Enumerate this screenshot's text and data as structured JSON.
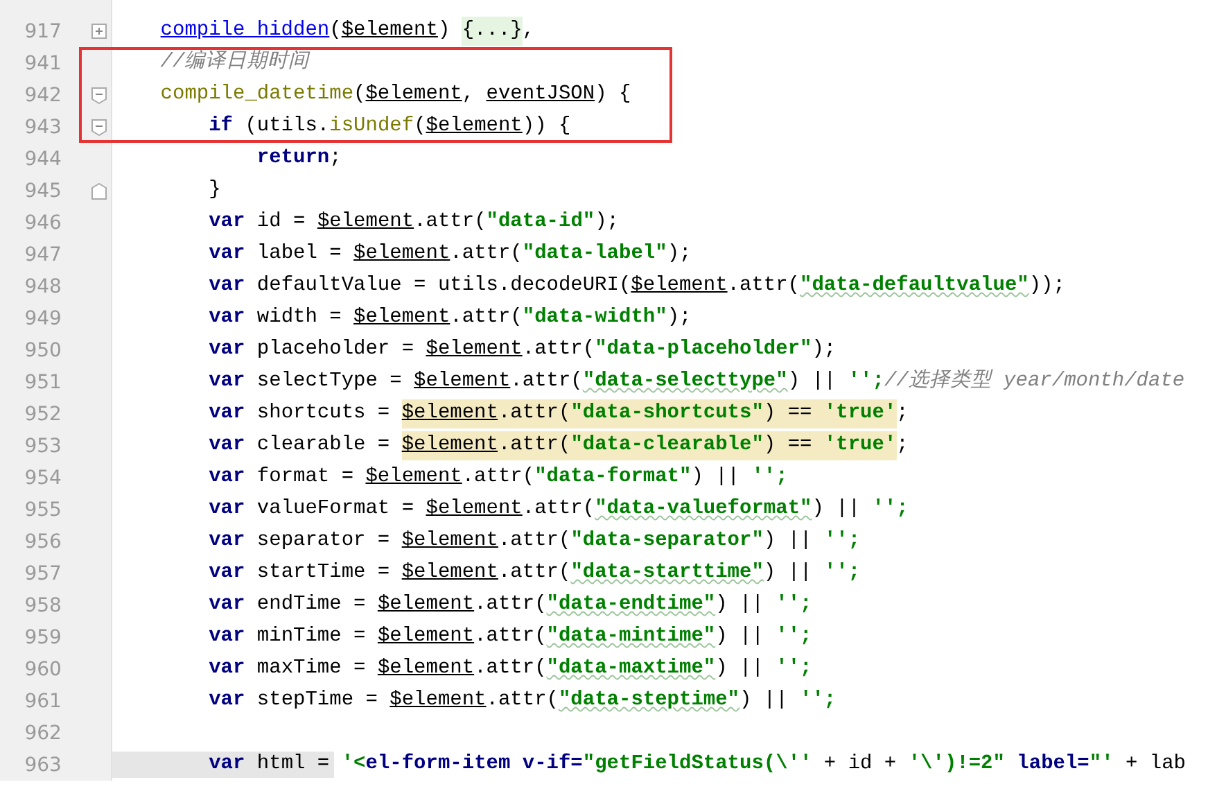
{
  "lines": [
    {
      "number": "917",
      "expanded": false,
      "tokens": [
        {
          "t": "compile hidden",
          "kind": "link"
        },
        {
          "t": "(",
          "kind": "plain"
        },
        {
          "t": "$element",
          "kind": "var"
        },
        {
          "t": ") ",
          "kind": "plain"
        },
        {
          "t": "{...}",
          "kind": "folded"
        },
        {
          "t": ",",
          "kind": "plain"
        }
      ]
    },
    {
      "number": "941",
      "boxed": true,
      "tokens": [
        {
          "t": "//编译日期时间",
          "kind": "comment"
        }
      ]
    },
    {
      "number": "942",
      "boxed": true,
      "expanded": true,
      "tokens": [
        {
          "t": "compile_datetime",
          "kind": "func"
        },
        {
          "t": "(",
          "kind": "plain"
        },
        {
          "t": "$element",
          "kind": "var"
        },
        {
          "t": ", ",
          "kind": "plain"
        },
        {
          "t": "eventJSON",
          "kind": "var"
        },
        {
          "t": ") {",
          "kind": "plain"
        }
      ],
      "children": [
        {
          "number": "943",
          "boxed": true,
          "expanded": true,
          "tokens": [
            {
              "t": "if",
              "kind": "keyword"
            },
            {
              "t": " (utils.",
              "kind": "plain"
            },
            {
              "t": "isUndef",
              "kind": "func"
            },
            {
              "t": "(",
              "kind": "plain"
            },
            {
              "t": "$element",
              "kind": "var"
            },
            {
              "t": ")) {",
              "kind": "plain"
            }
          ],
          "children": [
            {
              "number": "944",
              "tokens": [
                {
                  "t": "return",
                  "kind": "keyword"
                },
                {
                  "t": ";",
                  "kind": "plain"
                }
              ]
            }
          ]
        },
        {
          "number": "945",
          "block_end": true,
          "tokens": [
            {
              "t": "}",
              "kind": "plain"
            }
          ]
        },
        {
          "number": "946",
          "tokens": [
            {
              "t": "var",
              "kind": "keyword"
            },
            {
              "t": " id = ",
              "kind": "plain"
            },
            {
              "t": "$element",
              "kind": "var"
            },
            {
              "t": ".attr(",
              "kind": "plain"
            },
            {
              "t": "\"data-id\"",
              "kind": "string"
            },
            {
              "t": ");",
              "kind": "plain"
            }
          ]
        },
        {
          "number": "947",
          "tokens": [
            {
              "t": "var",
              "kind": "keyword"
            },
            {
              "t": " label = ",
              "kind": "plain"
            },
            {
              "t": "$element",
              "kind": "var"
            },
            {
              "t": ".attr(",
              "kind": "plain"
            },
            {
              "t": "\"data-label\"",
              "kind": "string"
            },
            {
              "t": ");",
              "kind": "plain"
            }
          ]
        },
        {
          "number": "948",
          "tokens": [
            {
              "t": "var",
              "kind": "keyword"
            },
            {
              "t": " defaultValue = utils.decodeURI(",
              "kind": "plain"
            },
            {
              "t": "$element",
              "kind": "var"
            },
            {
              "t": ".attr(",
              "kind": "plain"
            },
            {
              "t": "\"data-defaultvalue\"",
              "kind": "string",
              "typo": true
            },
            {
              "t": "));",
              "kind": "plain"
            }
          ]
        },
        {
          "number": "949",
          "tokens": [
            {
              "t": "var",
              "kind": "keyword"
            },
            {
              "t": " width = ",
              "kind": "plain"
            },
            {
              "t": "$element",
              "kind": "var"
            },
            {
              "t": ".attr(",
              "kind": "plain"
            },
            {
              "t": "\"data-width\"",
              "kind": "string"
            },
            {
              "t": ");",
              "kind": "plain"
            }
          ]
        },
        {
          "number": "950",
          "tokens": [
            {
              "t": "var",
              "kind": "keyword"
            },
            {
              "t": " placeholder = ",
              "kind": "plain"
            },
            {
              "t": "$element",
              "kind": "var"
            },
            {
              "t": ".attr(",
              "kind": "plain"
            },
            {
              "t": "\"data-placeholder\"",
              "kind": "string"
            },
            {
              "t": ");",
              "kind": "plain"
            }
          ]
        },
        {
          "number": "951",
          "tokens": [
            {
              "t": "var",
              "kind": "keyword"
            },
            {
              "t": " selectType = ",
              "kind": "plain"
            },
            {
              "t": "$element",
              "kind": "var"
            },
            {
              "t": ".attr(",
              "kind": "plain"
            },
            {
              "t": "\"data-selecttype\"",
              "kind": "string",
              "typo": true
            },
            {
              "t": ") || ",
              "kind": "plain"
            },
            {
              "t": "'';",
              "kind": "string"
            },
            {
              "t": "//选择类型 year/month/date",
              "kind": "comment"
            }
          ]
        },
        {
          "number": "952",
          "tokens": [
            {
              "t": "var",
              "kind": "keyword"
            },
            {
              "t": " shortcuts = ",
              "kind": "plain"
            },
            {
              "t": "$element",
              "kind": "var",
              "hl": true
            },
            {
              "t": ".attr(",
              "kind": "plain",
              "hl": true
            },
            {
              "t": "\"data-shortcuts\"",
              "kind": "string",
              "hl": true
            },
            {
              "t": ") == ",
              "kind": "plain",
              "hl": true
            },
            {
              "t": "'true'",
              "kind": "string",
              "hl": true
            },
            {
              "t": ";",
              "kind": "plain"
            }
          ]
        },
        {
          "number": "953",
          "tokens": [
            {
              "t": "var",
              "kind": "keyword"
            },
            {
              "t": " clearable = ",
              "kind": "plain"
            },
            {
              "t": "$element",
              "kind": "var",
              "hl": true
            },
            {
              "t": ".attr(",
              "kind": "plain",
              "hl": true
            },
            {
              "t": "\"data-clearable\"",
              "kind": "string",
              "hl": true
            },
            {
              "t": ") == ",
              "kind": "plain",
              "hl": true
            },
            {
              "t": "'true'",
              "kind": "string",
              "hl": true
            },
            {
              "t": ";",
              "kind": "plain"
            }
          ]
        },
        {
          "number": "954",
          "tokens": [
            {
              "t": "var",
              "kind": "keyword"
            },
            {
              "t": " format = ",
              "kind": "plain"
            },
            {
              "t": "$element",
              "kind": "var"
            },
            {
              "t": ".attr(",
              "kind": "plain"
            },
            {
              "t": "\"data-format\"",
              "kind": "string"
            },
            {
              "t": ") || ",
              "kind": "plain"
            },
            {
              "t": "'';",
              "kind": "string"
            }
          ]
        },
        {
          "number": "955",
          "tokens": [
            {
              "t": "var",
              "kind": "keyword"
            },
            {
              "t": " valueFormat = ",
              "kind": "plain"
            },
            {
              "t": "$element",
              "kind": "var"
            },
            {
              "t": ".attr(",
              "kind": "plain"
            },
            {
              "t": "\"data-valueformat\"",
              "kind": "string",
              "typo": true
            },
            {
              "t": ") || ",
              "kind": "plain"
            },
            {
              "t": "'';",
              "kind": "string"
            }
          ]
        },
        {
          "number": "956",
          "tokens": [
            {
              "t": "var",
              "kind": "keyword"
            },
            {
              "t": " separator = ",
              "kind": "plain"
            },
            {
              "t": "$element",
              "kind": "var"
            },
            {
              "t": ".attr(",
              "kind": "plain"
            },
            {
              "t": "\"data-separator\"",
              "kind": "string"
            },
            {
              "t": ") || ",
              "kind": "plain"
            },
            {
              "t": "'';",
              "kind": "string"
            }
          ]
        },
        {
          "number": "957",
          "tokens": [
            {
              "t": "var",
              "kind": "keyword"
            },
            {
              "t": " startTime = ",
              "kind": "plain"
            },
            {
              "t": "$element",
              "kind": "var"
            },
            {
              "t": ".attr(",
              "kind": "plain"
            },
            {
              "t": "\"data-starttime\"",
              "kind": "string",
              "typo": true
            },
            {
              "t": ") || ",
              "kind": "plain"
            },
            {
              "t": "'';",
              "kind": "string"
            }
          ]
        },
        {
          "number": "958",
          "tokens": [
            {
              "t": "var",
              "kind": "keyword"
            },
            {
              "t": " endTime = ",
              "kind": "plain"
            },
            {
              "t": "$element",
              "kind": "var"
            },
            {
              "t": ".attr(",
              "kind": "plain"
            },
            {
              "t": "\"data-endtime\"",
              "kind": "string",
              "typo": true
            },
            {
              "t": ") || ",
              "kind": "plain"
            },
            {
              "t": "'';",
              "kind": "string"
            }
          ]
        },
        {
          "number": "959",
          "tokens": [
            {
              "t": "var",
              "kind": "keyword"
            },
            {
              "t": " minTime = ",
              "kind": "plain"
            },
            {
              "t": "$element",
              "kind": "var"
            },
            {
              "t": ".attr(",
              "kind": "plain"
            },
            {
              "t": "\"data-mintime\"",
              "kind": "string",
              "typo": true
            },
            {
              "t": ") || ",
              "kind": "plain"
            },
            {
              "t": "'';",
              "kind": "string"
            }
          ]
        },
        {
          "number": "960",
          "tokens": [
            {
              "t": "var",
              "kind": "keyword"
            },
            {
              "t": " maxTime = ",
              "kind": "plain"
            },
            {
              "t": "$element",
              "kind": "var"
            },
            {
              "t": ".attr(",
              "kind": "plain"
            },
            {
              "t": "\"data-maxtime\"",
              "kind": "string",
              "typo": true
            },
            {
              "t": ") || ",
              "kind": "plain"
            },
            {
              "t": "'';",
              "kind": "string"
            }
          ]
        },
        {
          "number": "961",
          "tokens": [
            {
              "t": "var",
              "kind": "keyword"
            },
            {
              "t": " stepTime = ",
              "kind": "plain"
            },
            {
              "t": "$element",
              "kind": "var"
            },
            {
              "t": ".attr(",
              "kind": "plain"
            },
            {
              "t": "\"data-steptime\"",
              "kind": "string",
              "typo": true
            },
            {
              "t": ") || ",
              "kind": "plain"
            },
            {
              "t": "'';",
              "kind": "string"
            }
          ]
        },
        {
          "number": "962"
        },
        {
          "number": "963",
          "current": true,
          "tokens": [
            {
              "t": "var",
              "kind": "keyword"
            },
            {
              "t": " html = ",
              "kind": "plain"
            },
            {
              "t": "'<",
              "kind": "string"
            },
            {
              "t": "el-form-item v-if=",
              "kind": "tag"
            },
            {
              "t": "\"getFieldStatus(\\''",
              "kind": "string"
            },
            {
              "t": " + id + ",
              "kind": "plain"
            },
            {
              "t": "'\\')!=2\"",
              "kind": "string"
            },
            {
              "t": " label=",
              "kind": "tag"
            },
            {
              "t": "\"'",
              "kind": "string"
            },
            {
              "t": " + lab",
              "kind": "plain"
            }
          ]
        }
      ]
    }
  ]
}
